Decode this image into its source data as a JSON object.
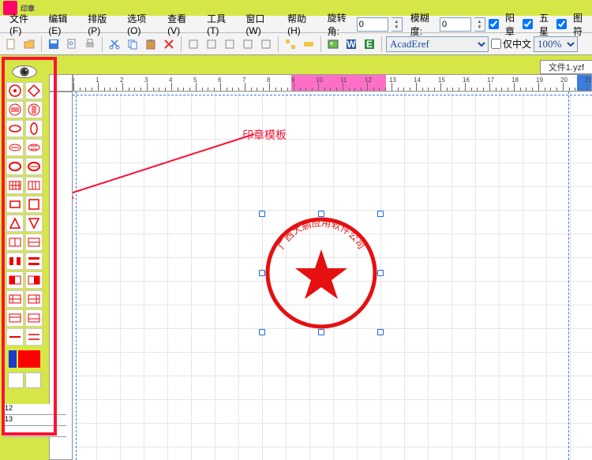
{
  "app": {
    "logo_text": "印章"
  },
  "menu": {
    "items": [
      "文件(F)",
      "编辑(E)",
      "排版(P)",
      "选项(O)",
      "查看(V)",
      "工具(T)",
      "窗口(W)",
      "帮助(H)"
    ],
    "rotate_label": "旋转角:",
    "rotate_val": "0",
    "blur_label": "模糊度:",
    "blur_val": "0",
    "cb_yang": "阳章",
    "cb_star": "五星",
    "cb_tufu": "图符"
  },
  "toolbar": {
    "font": "AcadEref",
    "zoom": "100%",
    "cb_cn": "仅中文"
  },
  "doc_tab": "文件1.yzf",
  "annotation": "印章模板",
  "stamp": {
    "text": "广西大鹏应用软件公司"
  },
  "ruler_nums": [
    "0",
    "1",
    "2",
    "3",
    "4",
    "5",
    "6",
    "7",
    "8",
    "9",
    "10",
    "11",
    "12",
    "13",
    "14",
    "15",
    "16",
    "17",
    "18",
    "19",
    "20",
    "21"
  ],
  "palette_names": [
    "circle-outline",
    "diamond-outline",
    "h-lines",
    "v-lines",
    "h-oval",
    "v-oval",
    "text-arc",
    "text-arc2",
    "oval-thick1",
    "oval-thick2",
    "grid3",
    "grid4",
    "rect1",
    "rect2",
    "tri1",
    "tri2",
    "layout1",
    "layout2",
    "split-h1",
    "split-h2",
    "split-v1",
    "split-v2",
    "layout-a",
    "layout-b",
    "layout-c",
    "layout-d",
    "line1",
    "line2"
  ],
  "colors": {
    "swatch1": "#1a3ad0",
    "swatch2": "#ff0000"
  }
}
